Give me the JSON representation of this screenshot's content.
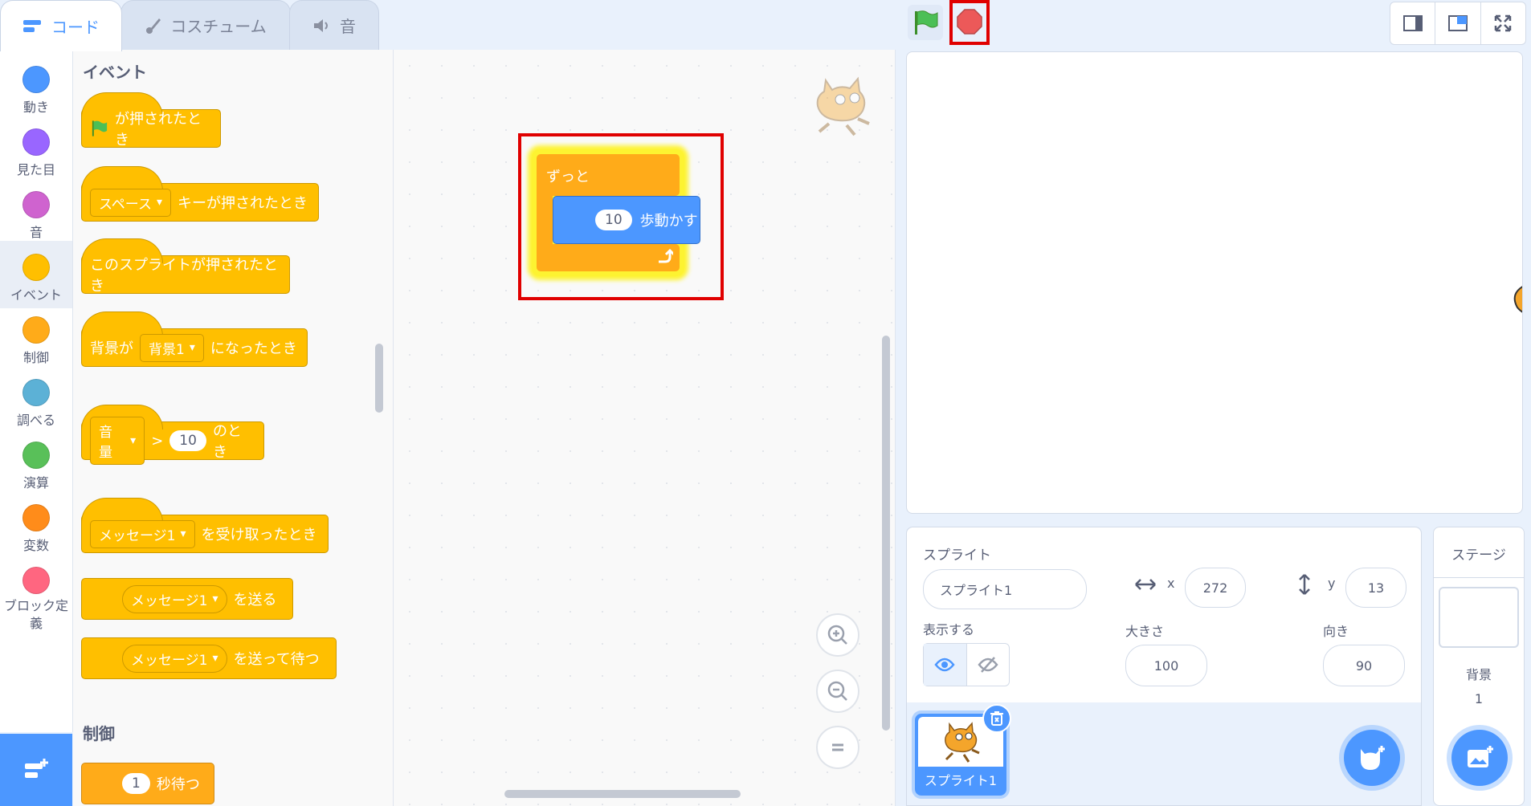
{
  "tabs": [
    {
      "label": "コード",
      "icon": "code-icon"
    },
    {
      "label": "コスチューム",
      "icon": "brush-icon"
    },
    {
      "label": "音",
      "icon": "speaker-icon"
    }
  ],
  "categories": [
    {
      "label": "動き",
      "color": "#4c97ff"
    },
    {
      "label": "見た目",
      "color": "#9966ff"
    },
    {
      "label": "音",
      "color": "#cf63cf"
    },
    {
      "label": "イベント",
      "color": "#ffbf00"
    },
    {
      "label": "制御",
      "color": "#ffab19"
    },
    {
      "label": "調べる",
      "color": "#5cb1d6"
    },
    {
      "label": "演算",
      "color": "#59c059"
    },
    {
      "label": "変数",
      "color": "#ff8c1a"
    },
    {
      "label": "ブロック定義",
      "color": "#ff6680"
    }
  ],
  "palette": {
    "events_title": "イベント",
    "control_title": "制御",
    "flag_clicked": "が押されたとき",
    "key_pressed": {
      "key": "スペース",
      "text": "キーが押されたとき"
    },
    "sprite_clicked": "このスプライトが押されたとき",
    "backdrop_switch": {
      "prefix": "背景が",
      "value": "背景1",
      "suffix": "になったとき"
    },
    "loudness": {
      "value": "音量",
      "op": ">",
      "num": "10",
      "suffix": "のとき"
    },
    "receive": {
      "value": "メッセージ1",
      "suffix": "を受け取ったとき"
    },
    "broadcast": {
      "value": "メッセージ1",
      "suffix": "を送る"
    },
    "broadcast_wait": {
      "value": "メッセージ1",
      "suffix": "を送って待つ"
    },
    "wait": {
      "num": "1",
      "suffix": "秒待つ"
    }
  },
  "script": {
    "forever": "ずっと",
    "move_num": "10",
    "move_text": "歩動かす"
  },
  "sprite_info": {
    "title": "スプライト",
    "name": "スプライト1",
    "x_label": "x",
    "x": "272",
    "y_label": "y",
    "y": "13",
    "show_label": "表示する",
    "size_label": "大きさ",
    "size": "100",
    "direction_label": "向き",
    "direction": "90"
  },
  "sprite_list": [
    {
      "name": "スプライト1"
    }
  ],
  "stage_panel": {
    "title": "ステージ",
    "backdrop_label": "背景",
    "backdrop_count": "1"
  },
  "colors": {
    "events": "#ffbf00",
    "motion": "#4c97ff",
    "control": "#ffab19",
    "highlight": "#e00000"
  }
}
